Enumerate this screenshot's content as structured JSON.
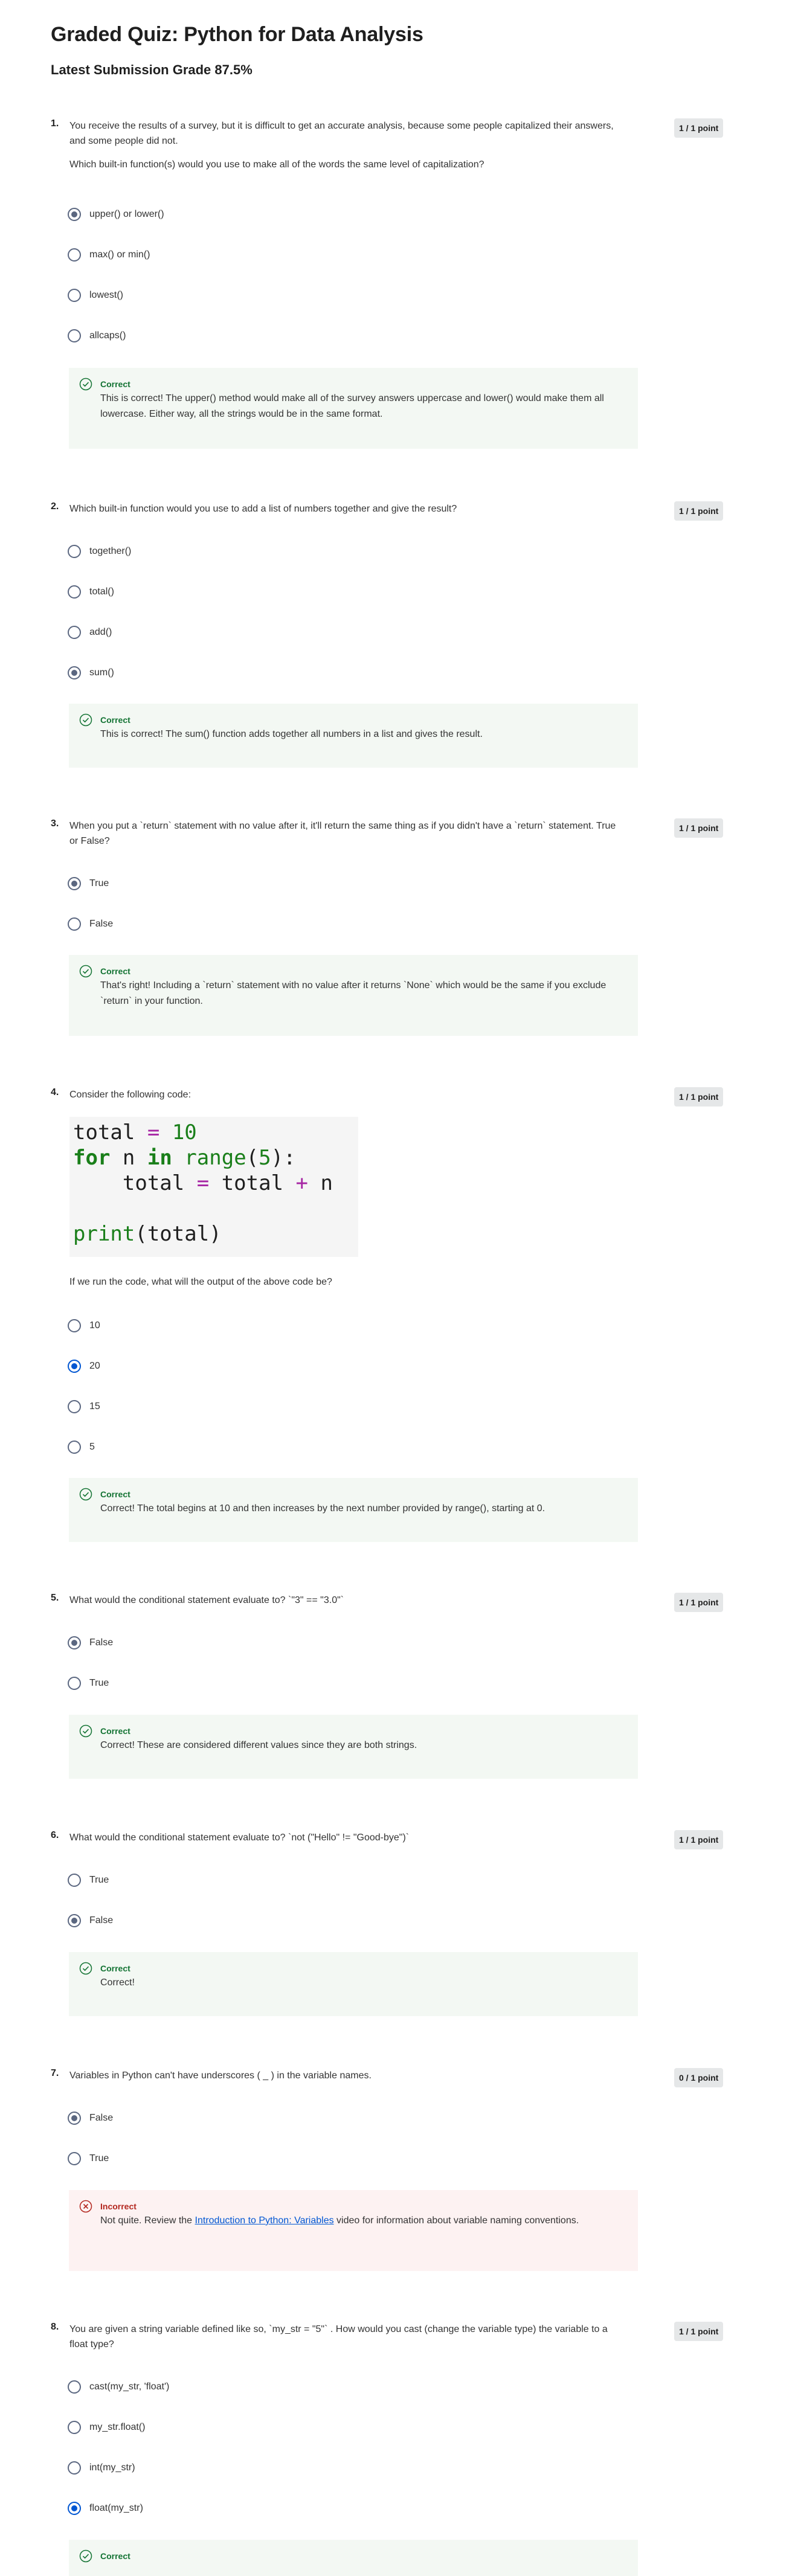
{
  "title": "Graded Quiz: Python for Data Analysis",
  "grade": "Latest Submission Grade 87.5%",
  "questions": [
    {
      "number": "1.",
      "text": [
        "You receive the results of a survey, but it is difficult to get an accurate analysis, because some people capitalized their answers, and some people did not.",
        "Which built-in function(s) would you use to make all of the words the same level of capitalization?"
      ],
      "points": "1 / 1 point",
      "options": [
        "upper() or lower()",
        "max() or min()",
        "lowest()",
        "allcaps()"
      ],
      "selected": 0,
      "feedback": {
        "status": "Correct",
        "text": "This is correct! The upper() method would make all of the survey answers uppercase and lower() would make them all lowercase. Either way, all the strings would be in the same format."
      }
    },
    {
      "number": "2.",
      "text": [
        "Which built-in function would you use to add a list of numbers together and give the result?"
      ],
      "points": "1 / 1 point",
      "options": [
        "together()",
        "total()",
        "add()",
        "sum()"
      ],
      "selected": 3,
      "feedback": {
        "status": "Correct",
        "text": "This is correct! The sum() function adds together all numbers in a list and gives the result."
      }
    },
    {
      "number": "3.",
      "text": [
        "When you put a `return` statement with no value after it, it'll return the same thing as if you didn't have a `return` statement. True or False?"
      ],
      "points": "1 / 1 point",
      "options": [
        "True",
        "False"
      ],
      "selected": 0,
      "feedback": {
        "status": "Correct",
        "text": "That's right! Including a `return` statement with no value after it returns `None` which would be the same if you exclude `return` in your function."
      }
    },
    {
      "number": "4.",
      "text": [
        "Consider the following code:"
      ],
      "after_code": "If we run the code, what will the output of the above code be?",
      "code_lines": [
        "total = 10",
        "for n in range(5):",
        "    total = total + n",
        "",
        "print(total)"
      ],
      "points": "1 / 1 point",
      "options": [
        "10",
        "20",
        "15",
        "5"
      ],
      "selected": 1,
      "feedback": {
        "status": "Correct",
        "text": "Correct! The total begins at 10 and then increases by the next number provided by range(), starting at 0."
      }
    },
    {
      "number": "5.",
      "text": [
        "What would the conditional statement evaluate to? `\"3\" == \"3.0\"`"
      ],
      "points": "1 / 1 point",
      "options": [
        "False",
        "True"
      ],
      "selected": 0,
      "feedback": {
        "status": "Correct",
        "text": "Correct! These are considered different values since they are both strings."
      }
    },
    {
      "number": "6.",
      "text": [
        "What would the conditional statement evaluate to? `not (\"Hello\" != \"Good-bye\")`"
      ],
      "points": "1 / 1 point",
      "options": [
        "True",
        "False"
      ],
      "selected": 1,
      "feedback": {
        "status": "Correct",
        "text": "Correct!"
      }
    },
    {
      "number": "7.",
      "text": [
        "Variables in Python can't have underscores ( _ ) in the variable names."
      ],
      "points": "0 / 1 point",
      "options": [
        "False",
        "True"
      ],
      "selected": 0,
      "feedback": {
        "status": "Incorrect",
        "text_before": "Not quite. Review the ",
        "link": "Introduction to Python: Variables",
        "text_after": " video for information about variable naming conventions."
      }
    },
    {
      "number": "8.",
      "text": [
        "You are given a string variable defined like so, `my_str = \"5\"` . How would you cast (change the variable type) the variable to a float type?"
      ],
      "points": "1 / 1 point",
      "options": [
        "cast(my_str, 'float')",
        "my_str.float()",
        "int(my_str)",
        "float(my_str)"
      ],
      "selected": 3,
      "feedback": {
        "status": "Correct",
        "text": ""
      }
    }
  ],
  "colors": {
    "correct": "#137333",
    "incorrect": "#b3261e",
    "link": "#0056d2",
    "feedback_correct_bg": "#f3f8f3",
    "feedback_incorrect_bg": "#fdf2f2"
  }
}
